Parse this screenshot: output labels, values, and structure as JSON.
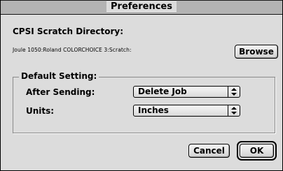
{
  "window": {
    "title": "Preferences"
  },
  "scratch": {
    "heading": "CPSI Scratch Directory:",
    "path": "Joule 1050:Roland COLORCHOICE 3:Scratch:",
    "browse_label": "Browse"
  },
  "defaults": {
    "group_title": "Default Setting:",
    "after_sending": {
      "label": "After Sending:",
      "value": "Delete Job"
    },
    "units": {
      "label": "Units:",
      "value": "Inches"
    }
  },
  "actions": {
    "cancel_label": "Cancel",
    "ok_label": "OK"
  },
  "icons": {
    "popup_arrows": "updown-arrows-icon"
  }
}
